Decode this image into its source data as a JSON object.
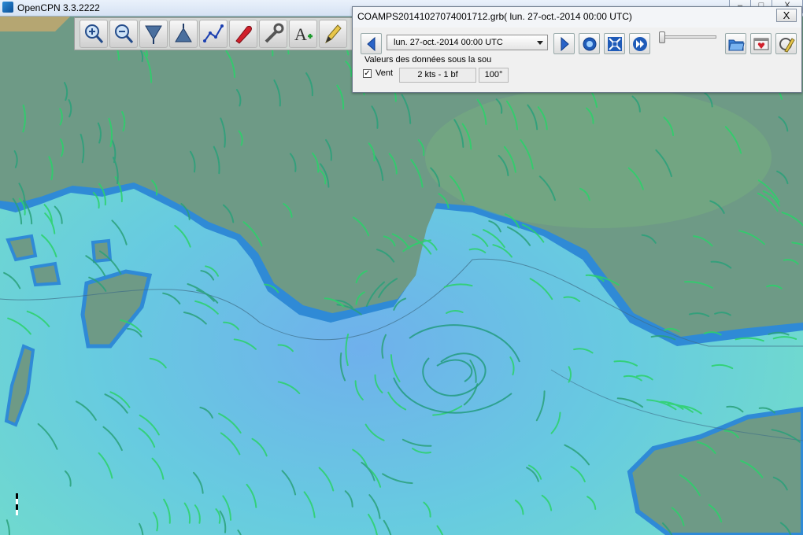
{
  "window": {
    "title": "OpenCPN 3.3.2222",
    "minimize_label": "–",
    "maximize_label": "□",
    "close_label": "X"
  },
  "toolbar": {
    "buttons": [
      {
        "name": "zoom-in-icon"
      },
      {
        "name": "zoom-out-icon"
      },
      {
        "name": "scale-in-icon"
      },
      {
        "name": "scale-out-icon"
      },
      {
        "name": "route-icon"
      },
      {
        "name": "boat-follow-icon"
      },
      {
        "name": "settings-wrench-icon"
      },
      {
        "name": "text-add-icon"
      },
      {
        "name": "pencil-icon"
      }
    ]
  },
  "grib": {
    "title": "COAMPS20141027074001712.grb( lun. 27-oct.-2014 00:00  UTC)",
    "close_label": "X",
    "time_value": "lun. 27-oct.-2014 00:00  UTC",
    "data_under_cursor_label": "Valeurs des données sous la sou",
    "wind_checkbox_checked": true,
    "wind_label": "Vent",
    "wind_speed": "2 kts -  1 bf",
    "wind_direction": "100°",
    "buttons": [
      {
        "name": "prev-record-icon"
      },
      {
        "name": "next-record-icon"
      },
      {
        "name": "now-icon"
      },
      {
        "name": "zoom-to-center-icon"
      },
      {
        "name": "play-icon"
      },
      {
        "name": "open-file-icon"
      },
      {
        "name": "settings-icon"
      },
      {
        "name": "request-icon"
      }
    ]
  },
  "map": {
    "water_color": "#6fd8d0",
    "deep_water_color": "#6fb7e8",
    "land_color": "#6e9a86",
    "shore_color": "#2f8ad6",
    "wind_line_color": "#2bd26a"
  }
}
